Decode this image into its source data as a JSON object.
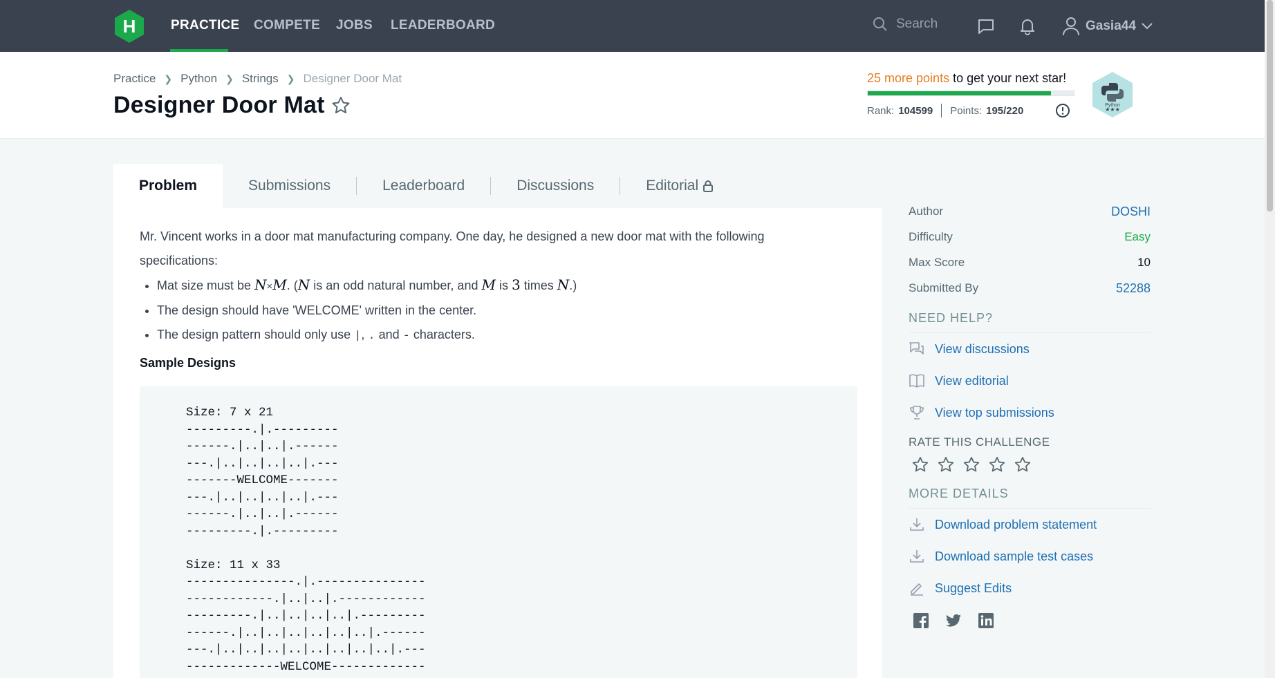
{
  "nav": {
    "items": [
      "PRACTICE",
      "COMPETE",
      "JOBS",
      "LEADERBOARD"
    ],
    "search_placeholder": "Search",
    "username": "Gasia44",
    "logo_letter": "H"
  },
  "breadcrumb": [
    "Practice",
    "Python",
    "Strings",
    "Designer Door Mat"
  ],
  "title": "Designer Door Mat",
  "progress": {
    "highlight": "25 more points",
    "rest": " to get your next star!",
    "fraction": 0.89,
    "rank_label": "Rank:",
    "rank": "104599",
    "points_label": "Points:",
    "points": "195/220",
    "badge_label": "Python"
  },
  "tabs": [
    "Problem",
    "Submissions",
    "Leaderboard",
    "Discussions",
    "Editorial"
  ],
  "problem": {
    "intro": "Mr. Vincent works in a door mat manufacturing company. One day, he designed a new door mat with the following specifications:",
    "bullet1": {
      "a": "Mat size must be ",
      "b": "N",
      "c": "×",
      "d": "M",
      "e": ". (",
      "f": "N",
      "g": " is an odd natural number, and ",
      "h": "M",
      "i": " is ",
      "j": "3",
      "k": " times ",
      "l": "N",
      "m": ".)"
    },
    "bullet2": "The design should have 'WELCOME' written in the center.",
    "bullet3": {
      "a": "The design pattern should only use ",
      "code1": "|",
      "b": ", ",
      "code2": ".",
      "c": " and ",
      "code3": "-",
      "d": " characters."
    },
    "sample_heading": "Sample Designs",
    "sample_code": "Size: 7 x 21\n---------.|.---------\n------.|..|..|.------\n---.|..|..|..|..|.---\n-------WELCOME-------\n---.|..|..|..|..|.---\n------.|..|..|.------\n---------.|.---------\n\nSize: 11 x 33\n---------------.|.---------------\n------------.|..|..|.------------\n---------.|..|..|..|..|.---------\n------.|..|..|..|..|..|..|.------\n---.|..|..|..|..|..|..|..|..|.---\n-------------WELCOME-------------"
  },
  "sidebar": {
    "author_label": "Author",
    "author": "DOSHI",
    "difficulty_label": "Difficulty",
    "difficulty": "Easy",
    "maxscore_label": "Max Score",
    "maxscore": "10",
    "submitted_label": "Submitted By",
    "submitted": "52288",
    "need_help": "NEED HELP?",
    "help_links": [
      "View discussions",
      "View editorial",
      "View top submissions"
    ],
    "rate": "RATE THIS CHALLENGE",
    "more_details": "MORE DETAILS",
    "detail_links": [
      "Download problem statement",
      "Download sample test cases",
      "Suggest Edits"
    ]
  },
  "colors": {
    "accent": "#1ba94c",
    "nav_bg": "#39424e",
    "link": "#1f6fb3",
    "orange": "#e77d1e"
  }
}
